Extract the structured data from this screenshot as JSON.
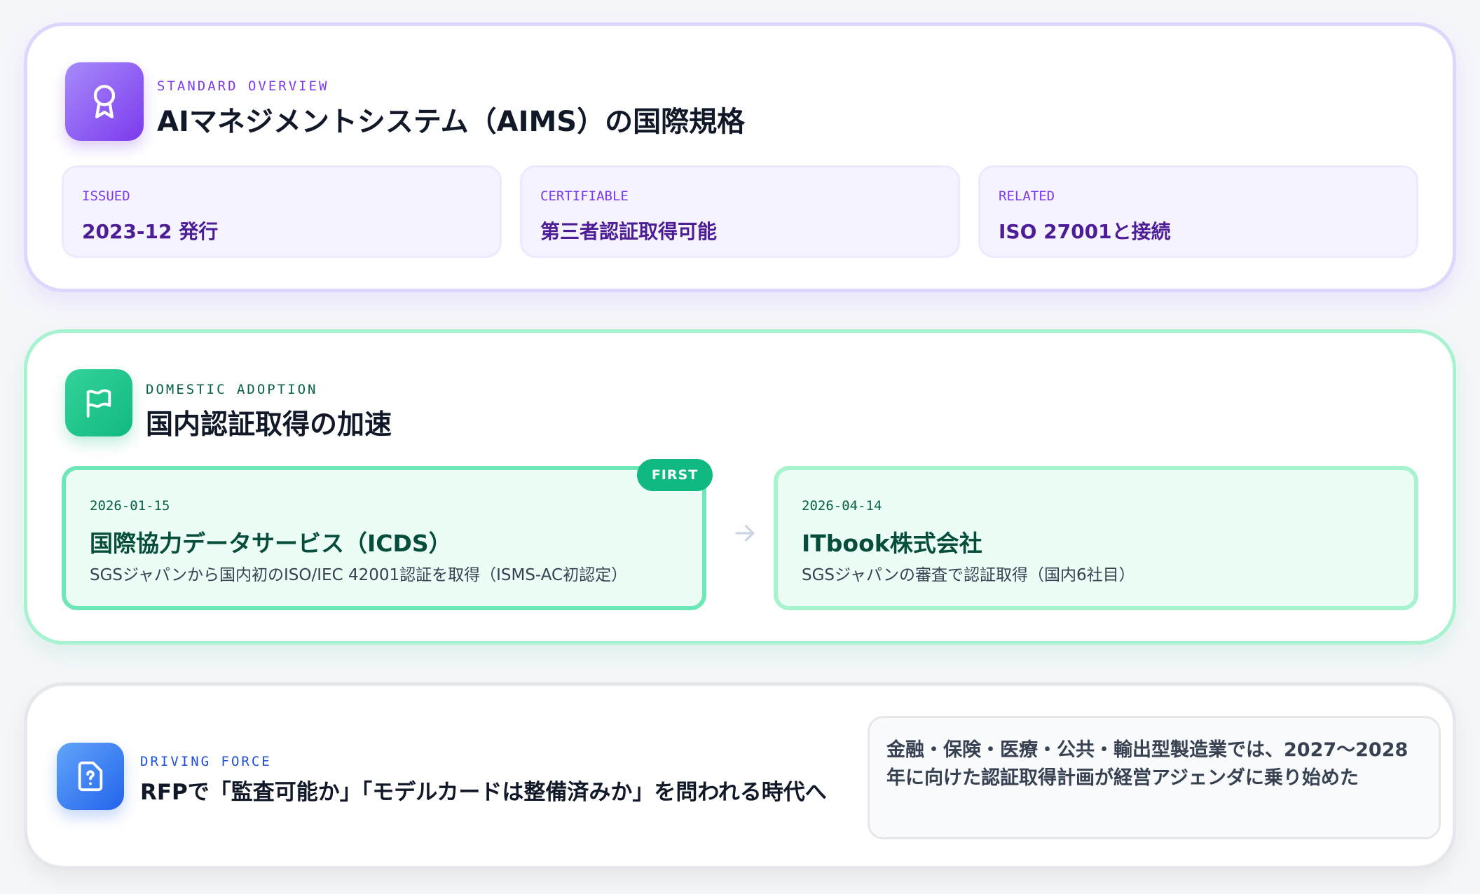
{
  "standard": {
    "kicker": "STANDARD OVERVIEW",
    "title": "AIマネジメントシステム（AIMS）の国際規格",
    "icon": "award-icon",
    "facts": [
      {
        "label": "ISSUED",
        "value": "2023-12 発行"
      },
      {
        "label": "CERTIFIABLE",
        "value": "第三者認証取得可能"
      },
      {
        "label": "RELATED",
        "value": "ISO 27001と接続"
      }
    ]
  },
  "adoption": {
    "kicker": "DOMESTIC ADOPTION",
    "title": "国内認証取得の加速",
    "icon": "flag-icon",
    "badge": "FIRST",
    "events": [
      {
        "date": "2026-01-15",
        "name": "国際協力データサービス（ICDS）",
        "desc": "SGSジャパンから国内初のISO/IEC 42001認証を取得（ISMS-AC初認定）"
      },
      {
        "date": "2026-04-14",
        "name": "ITbook株式会社",
        "desc": "SGSジャパンの審査で認証取得（国内6社目）"
      }
    ]
  },
  "driving": {
    "kicker": "DRIVING FORCE",
    "title": "RFPで「監査可能か」「モデルカードは整備済みか」を問われる時代へ",
    "icon": "document-question-icon",
    "note": "金融・保険・医療・公共・輸出型製造業では、2027〜2028年に向けた認証取得計画が経営アジェンダに乗り始めた"
  },
  "colors": {
    "purple": "#7c3aed",
    "green": "#10b981",
    "blue": "#2563eb"
  }
}
